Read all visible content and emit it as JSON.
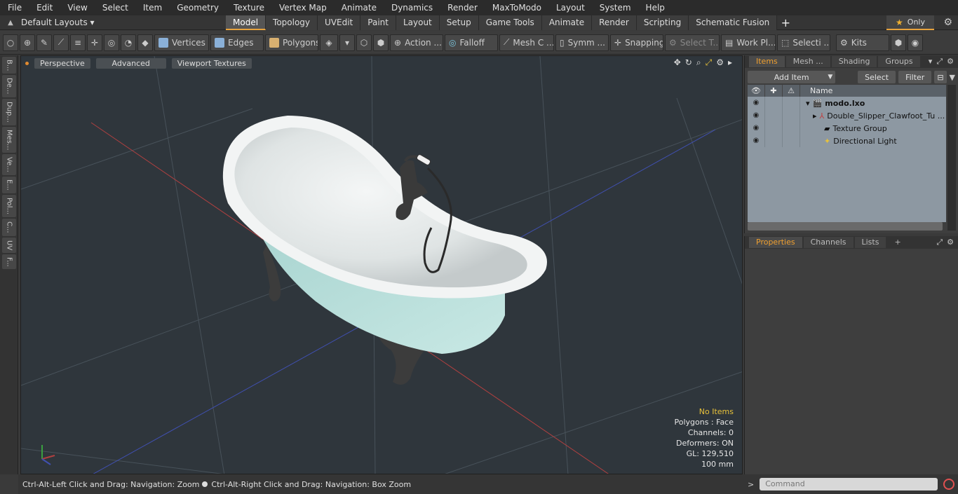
{
  "menu": [
    "File",
    "Edit",
    "View",
    "Select",
    "Item",
    "Geometry",
    "Texture",
    "Vertex Map",
    "Animate",
    "Dynamics",
    "Render",
    "MaxToModo",
    "Layout",
    "System",
    "Help"
  ],
  "layout_label": "Default Layouts ▾",
  "modes": [
    "Model",
    "Topology",
    "UVEdit",
    "Paint",
    "Layout",
    "Setup",
    "Game Tools",
    "Animate",
    "Render",
    "Scripting",
    "Schematic Fusion"
  ],
  "active_mode": "Model",
  "only_label": "Only",
  "toolbar": {
    "vertices": "Vertices",
    "edges": "Edges",
    "polygons": "Polygons",
    "action": "Action ...",
    "falloff": "Falloff",
    "mesh": "Mesh C ...",
    "symmetry": "Symm ...",
    "snapping": "Snapping",
    "select_t": "Select T...",
    "workplane": "Work Pl...",
    "selection": "Selecti ...",
    "kits": "Kits"
  },
  "left_tabs": [
    "B...",
    "De...",
    "Dup...",
    "Mes...",
    "Ve...",
    "E...",
    "Pol...",
    "C...",
    "UV",
    "F..."
  ],
  "viewport": {
    "perspective": "Perspective",
    "advanced": "Advanced",
    "textures": "Viewport Textures",
    "stats": {
      "selection": "No Items",
      "polygons": "Polygons : Face",
      "channels": "Channels: 0",
      "deformers": "Deformers: ON",
      "gl": "GL: 129,510",
      "scale": "100 mm"
    }
  },
  "status": {
    "left": "Ctrl-Alt-Left Click and Drag: Navigation: Zoom",
    "right": "Ctrl-Alt-Right Click and Drag: Navigation: Box Zoom"
  },
  "items_panel": {
    "tabs": [
      "Items",
      "Mesh ...",
      "Shading",
      "Groups"
    ],
    "add_item": "Add Item",
    "select": "Select",
    "filter": "Filter",
    "name_header": "Name",
    "rows": [
      {
        "name": "modo.lxo"
      },
      {
        "name": "Double_Slipper_Clawfoot_Tu ..."
      },
      {
        "name": "Texture Group"
      },
      {
        "name": "Directional Light"
      }
    ]
  },
  "props_panel": {
    "tabs": [
      "Properties",
      "Channels",
      "Lists"
    ]
  },
  "command_placeholder": "Command",
  "colors": {
    "accent": "#e8a33d",
    "viewport_bg": "#2f363c",
    "tub_body": "#b5dcd8"
  }
}
